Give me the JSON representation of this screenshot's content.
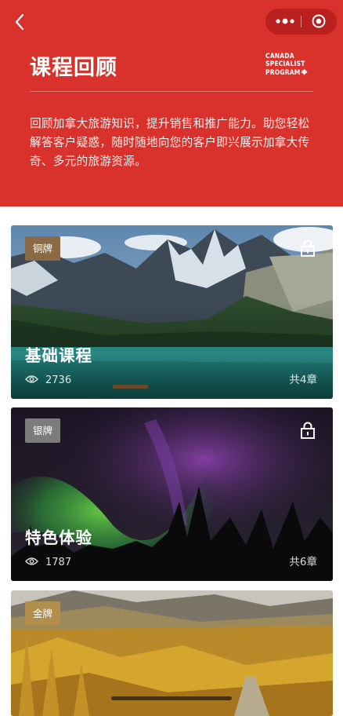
{
  "header": {
    "title": "课程回顾",
    "description": "回顾加拿大旅游知识，提升销售和推广能力。助您轻松解答客户疑惑，随时随地向您的客户即兴展示加拿大传奇、多元的旅游资源。",
    "logo_lines": [
      "CANADA",
      "SPECIALIST",
      "PROGRAM"
    ],
    "brand_color": "#d9322c"
  },
  "nav": {
    "back_icon": "chevron-left-icon",
    "more_icon": "more-dots-icon",
    "close_icon": "target-icon"
  },
  "courses": [
    {
      "badge": "铜牌",
      "badge_color": "#8a6a45",
      "title": "基础课程",
      "views": "2736",
      "chapters": "共4章",
      "locked": true
    },
    {
      "badge": "银牌",
      "badge_color": "#7c7c7c",
      "title": "特色体验",
      "views": "1787",
      "chapters": "共6章",
      "locked": true
    },
    {
      "badge": "金牌",
      "badge_color": "#b08f4d",
      "title": "",
      "views": "",
      "chapters": "",
      "locked": false
    }
  ]
}
